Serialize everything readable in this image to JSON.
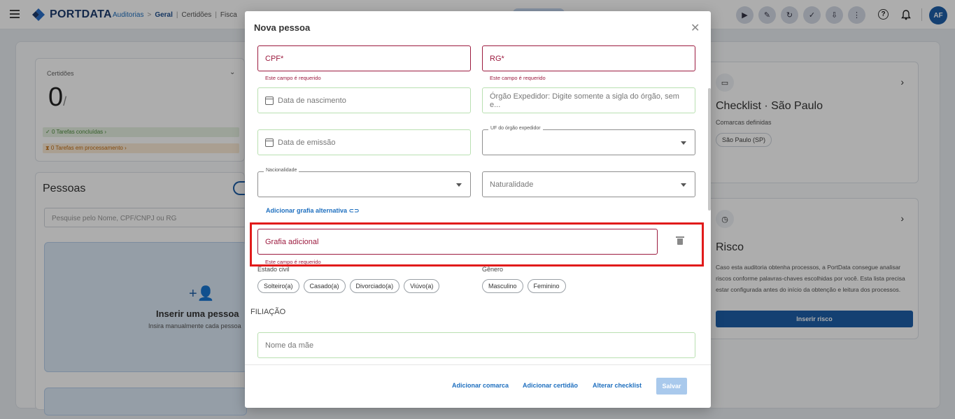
{
  "topbar": {
    "logo": "PORTDATA",
    "breadcrumb": {
      "root": "Auditorias",
      "sep": ">",
      "current": "Geral",
      "pipe": "|",
      "item1": "Certidões",
      "item2": "Fisca"
    },
    "avatar": "AF",
    "icons": [
      "play-circle-icon",
      "edit-icon",
      "refresh-icon",
      "shield-check-icon",
      "download-icon",
      "more-vert-icon",
      "help-icon",
      "bell-icon"
    ]
  },
  "background": {
    "certs": {
      "label": "Certidões",
      "count": "0",
      "slash": "/",
      "done": "0 Tarefas concluídas",
      "processing": "0 Tarefas em processamento"
    },
    "pessoas": {
      "title": "Pessoas",
      "search_placeholder": "Pesquise pelo Nome, CPF/CNPJ ou RG",
      "insert_title": "Inserir uma pessoa",
      "insert_sub": "Insira manualmente cada pessoa"
    },
    "checklist": {
      "title": "Checklist · São Paulo",
      "sub": "Comarcas definidas",
      "chip": "São Paulo (SP)"
    },
    "risco": {
      "title": "Risco",
      "desc": "Caso esta auditoria obtenha processos, a PortData consegue analisar riscos conforme palavras-chaves escolhidas por você. Esta lista precisa estar configurada antes do início da obtenção e leitura dos processos.",
      "button": "Inserir risco"
    }
  },
  "modal": {
    "title": "Nova pessoa",
    "required_error": "Este campo é requerido",
    "fields": {
      "cpf": "CPF*",
      "rg": "RG*",
      "birth": "Data de nascimento",
      "issuer": "Órgão Expedidor: Digite somente a sigla do órgão, sem e...",
      "issue_date": "Data de emissão",
      "uf_legend": "UF do órgão expedidor",
      "nat_legend": "Nacionalidade",
      "naturalidade": "Naturalidade",
      "grafia": "Grafia adicional",
      "mother": "Nome da mãe"
    },
    "add_grafia_link": "Adicionar grafia alternativa",
    "estado_civil": {
      "label": "Estado civil",
      "options": [
        "Solteiro(a)",
        "Casado(a)",
        "Divorciado(a)",
        "Viúvo(a)"
      ]
    },
    "genero": {
      "label": "Gênero",
      "options": [
        "Masculino",
        "Feminino"
      ]
    },
    "filiacao": "FILIAÇÃO",
    "footer": {
      "add_comarca": "Adicionar comarca",
      "add_certidao": "Adicionar certidão",
      "alter_checklist": "Alterar checklist",
      "save": "Salvar"
    }
  },
  "colors": {
    "primary": "#1e5fa8",
    "error": "#9c1b3f",
    "valid_border": "#b9e0b1",
    "highlight": "#e11b1b"
  }
}
